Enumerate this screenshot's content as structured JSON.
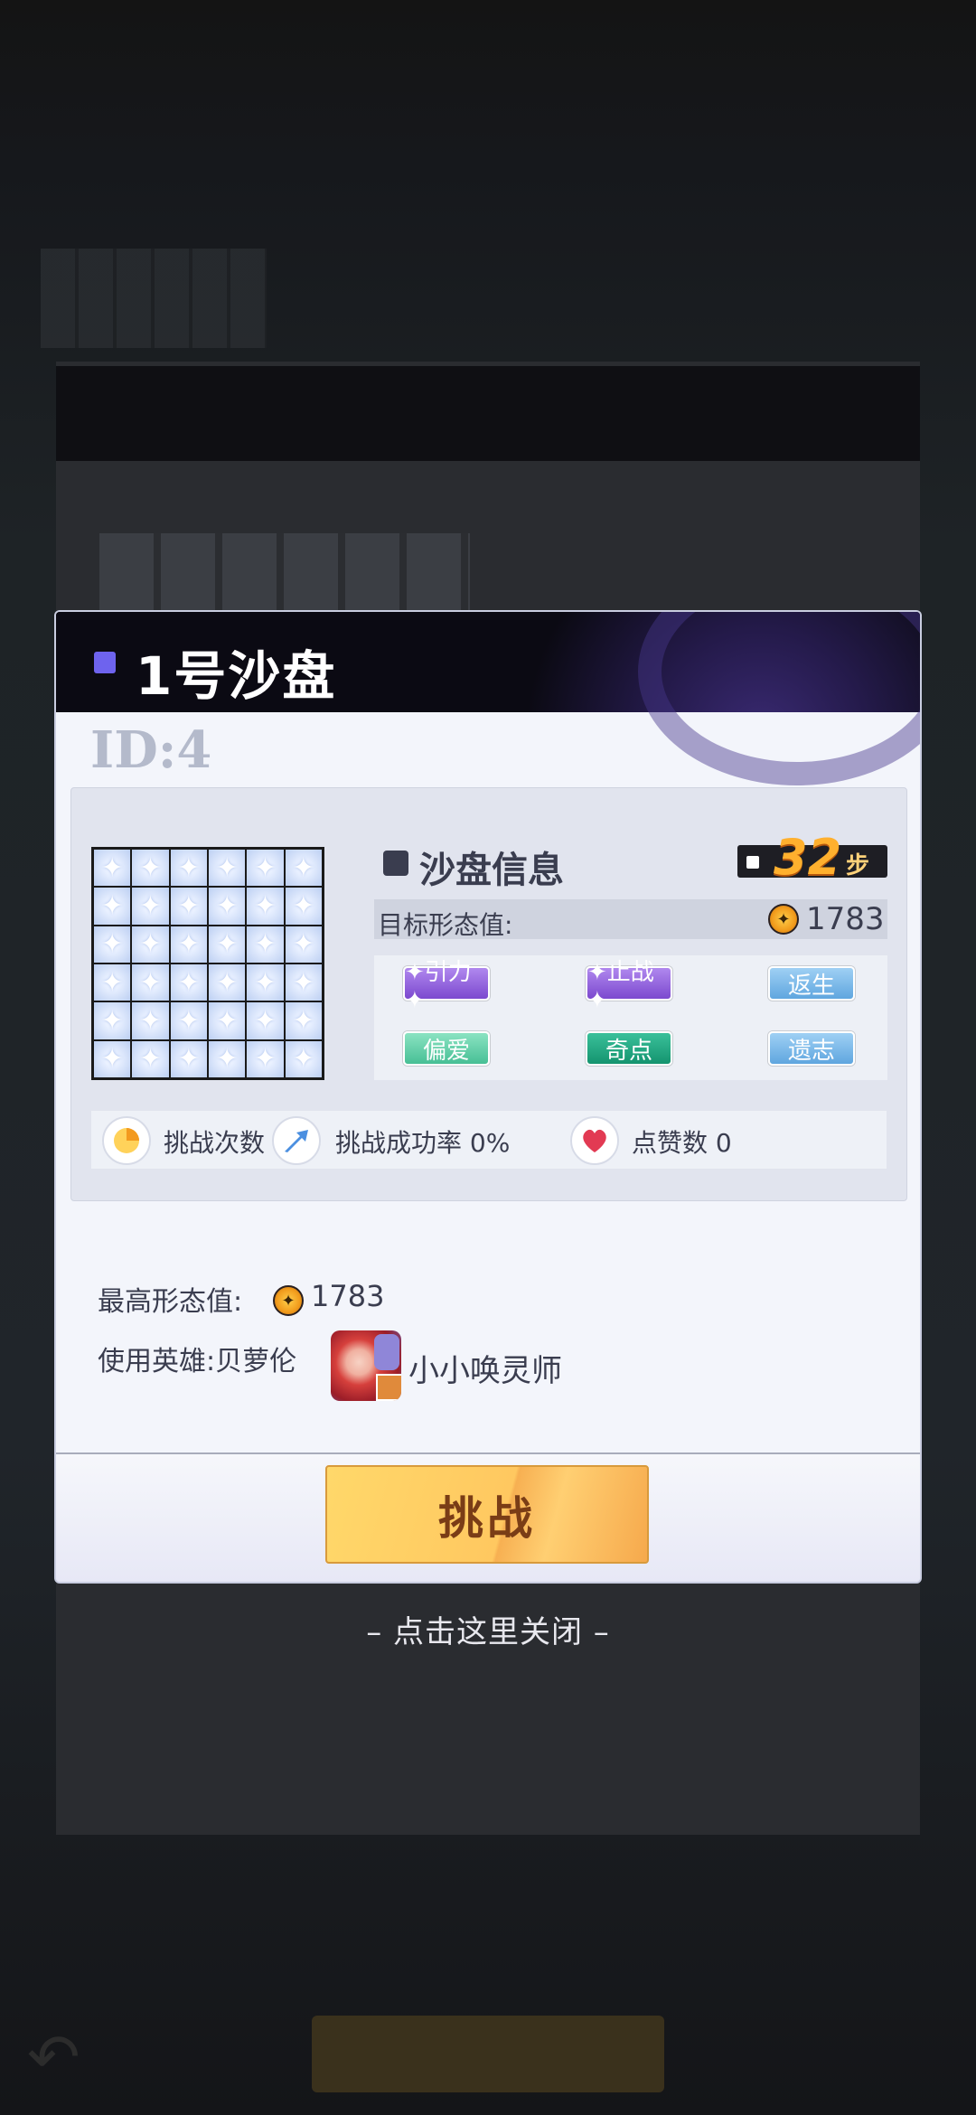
{
  "modal": {
    "title": "1号沙盘",
    "id_label": "ID:4",
    "info_title": "沙盘信息",
    "steps_value": "32",
    "steps_unit": "步",
    "target_label": "目标形态值:",
    "target_value": "1783",
    "tags": [
      "✦引力✦",
      "✦止战✦",
      "返生",
      "偏爱",
      "奇点",
      "遗志"
    ],
    "stats": {
      "attempts": "挑战次数  0",
      "success_rate": "挑战成功率 0%",
      "likes": "点赞数  0"
    },
    "best_label": "最高形态值:",
    "best_value": "1783",
    "hero_label": "使用英雄:贝萝伦",
    "hero_player": "小小唤灵师",
    "challenge_button": "挑战"
  },
  "close_hint": "– 点击这里关闭 –",
  "colors": {
    "title_mark": "#6e63ee",
    "steps_number": "#ffb02e",
    "tag_purple": "#8a56d8",
    "tag_blue": "#6fb1e5",
    "tag_green": "#5ccda5",
    "tag_teal": "#1aa27a",
    "challenge_button": "#ffcc5f"
  },
  "icons": {
    "attempts": "pie-chart-icon",
    "success_rate": "trend-arrow-icon",
    "likes": "heart-icon",
    "coin": "gold-coin-icon"
  }
}
